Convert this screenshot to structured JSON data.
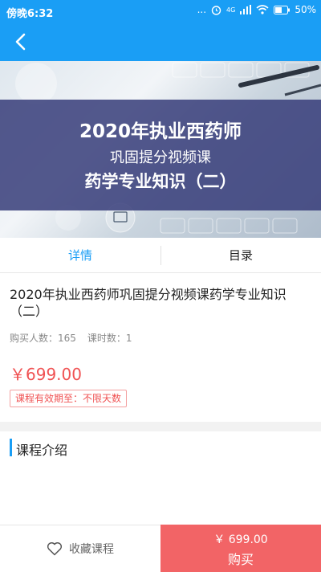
{
  "status_bar": {
    "time": "傍晚6:32",
    "dots": "...",
    "network": "4G",
    "battery": "50%"
  },
  "nav": {
    "back_icon": "chevron-left-icon"
  },
  "banner": {
    "line1": "2020年执业西药师",
    "line2": "巩固提分视频课",
    "line3": "药学专业知识（二）"
  },
  "tabs": [
    {
      "label": "详情",
      "active": true
    },
    {
      "label": "目录",
      "active": false
    }
  ],
  "course": {
    "title": "2020年执业西药师巩固提分视频课药学专业知识（二）",
    "buyers_label": "购买人数：165",
    "lessons_label": "课时数：1",
    "price": "￥699.00",
    "validity": "课程有效期至：不限天数"
  },
  "section": {
    "title": "课程介绍"
  },
  "bottom_bar": {
    "favorite_label": "收藏课程",
    "favorite_icon": "heart-icon",
    "buy_price": "￥ 699.00",
    "buy_label": "购买"
  },
  "colors": {
    "primary": "#1a9ef5",
    "accent_red": "#f05253",
    "buy_button": "#f26466"
  }
}
